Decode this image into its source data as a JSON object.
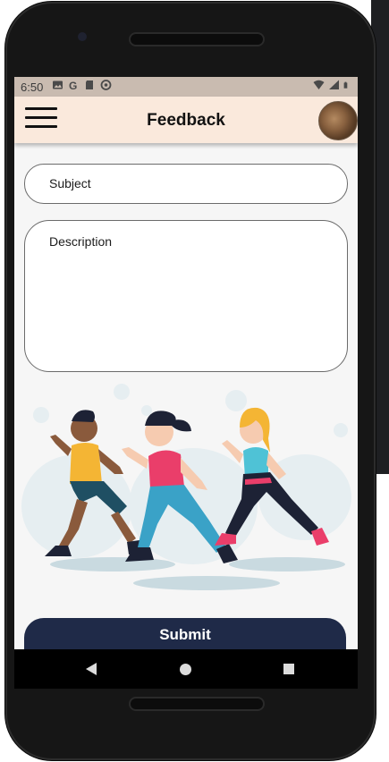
{
  "status_bar": {
    "time": "6:50",
    "icons": [
      "image-icon",
      "google-icon",
      "sd-card-icon",
      "data-saver-icon"
    ],
    "right_icons": [
      "wifi-icon",
      "signal-icon",
      "battery-icon"
    ]
  },
  "app_bar": {
    "title": "Feedback",
    "menu_icon": "hamburger-menu-icon",
    "avatar": "profile-avatar"
  },
  "form": {
    "subject": {
      "placeholder": "Subject"
    },
    "description": {
      "placeholder": "Description"
    },
    "submit_label": "Submit"
  },
  "illustration": "people-dancing-exercise",
  "navigation": [
    "back",
    "home",
    "recents"
  ],
  "colors": {
    "app_bar": "#fae9dc",
    "status_bar": "#c9bbb0",
    "submit_button": "#1f2a48",
    "screen_background": "#f6f6f6"
  }
}
